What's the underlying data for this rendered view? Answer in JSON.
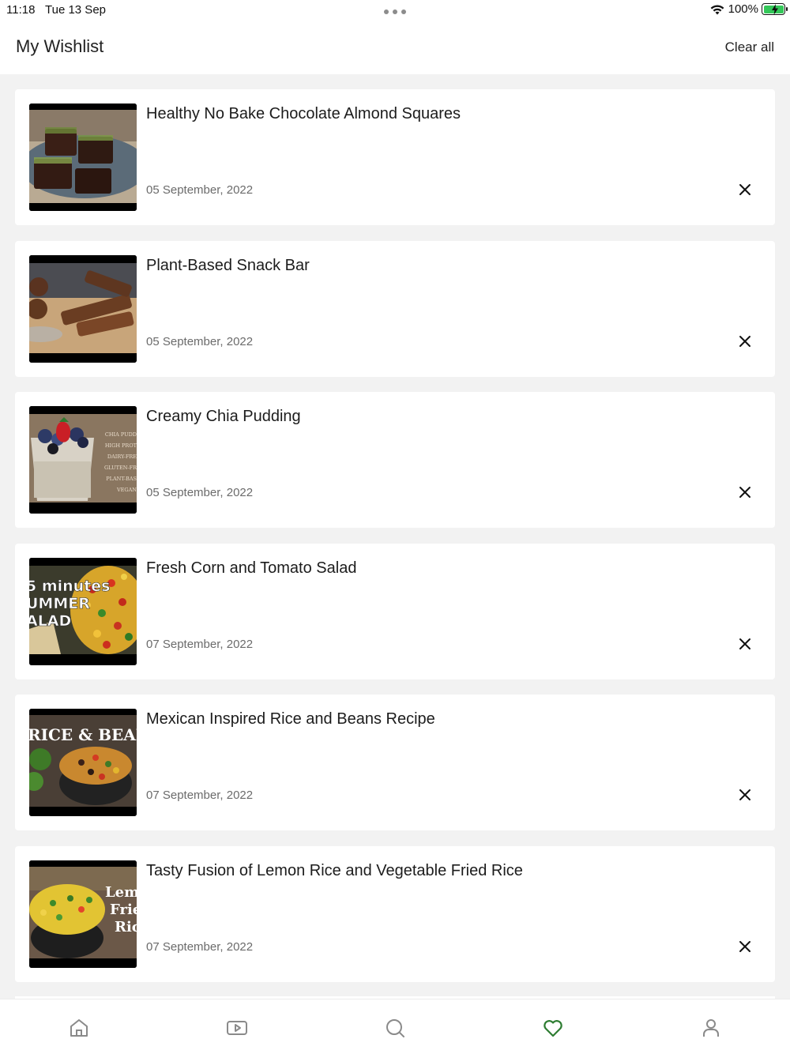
{
  "status_bar": {
    "time": "11:18",
    "date": "Tue 13 Sep",
    "battery": "100%",
    "icons": [
      "wifi-icon",
      "battery-charging-icon"
    ]
  },
  "header": {
    "title": "My Wishlist",
    "clear_all_label": "Clear all"
  },
  "items": [
    {
      "title": "Healthy No Bake Chocolate Almond Squares",
      "date": "05 September, 2022"
    },
    {
      "title": "Plant-Based Snack Bar",
      "date": "05 September, 2022"
    },
    {
      "title": "Creamy Chia Pudding",
      "date": "05 September, 2022"
    },
    {
      "title": "Fresh Corn and Tomato Salad",
      "date": "07 September, 2022"
    },
    {
      "title": "Mexican Inspired Rice and Beans Recipe",
      "date": "07 September, 2022"
    },
    {
      "title": "Tasty Fusion of Lemon Rice and Vegetable Fried Rice",
      "date": "07 September, 2022"
    }
  ],
  "thumbnail_text": {
    "chia": [
      "CHIA PUDD",
      "HIGH PROT",
      "DAIRY-FRE",
      "GLUTEN-FR",
      "PLANT-BAS",
      "VEGAN"
    ],
    "salad": [
      "5 minutes",
      "UMMER",
      "ALAD"
    ],
    "rice_beans": "RICE & BEANS",
    "lemon": [
      "Lem",
      "Frie",
      "Ric"
    ]
  },
  "tabbar": {
    "tabs": [
      {
        "icon": "home-icon",
        "active": false
      },
      {
        "icon": "video-play-icon",
        "active": false
      },
      {
        "icon": "search-icon",
        "active": false
      },
      {
        "icon": "heart-icon",
        "active": true
      },
      {
        "icon": "user-icon",
        "active": false
      }
    ],
    "active_color": "#2e7d32",
    "inactive_color": "#8a8a8a"
  }
}
